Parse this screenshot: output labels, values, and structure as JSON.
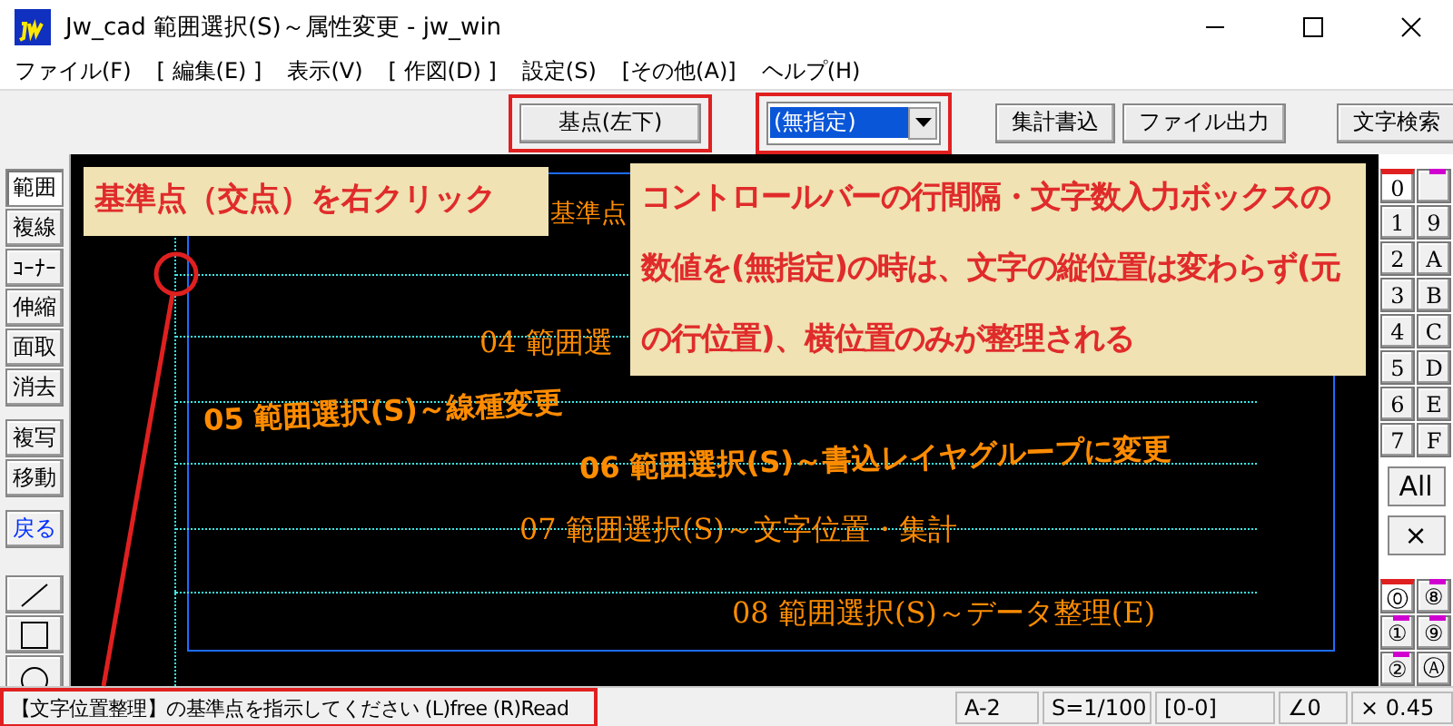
{
  "window": {
    "title": "Jw_cad 範囲選択(S)～属性変更 - jw_win"
  },
  "menu": [
    "ファイル(F)",
    "[ 編集(E) ]",
    "表示(V)",
    "[ 作図(D) ]",
    "設定(S)",
    "[その他(A)]",
    "ヘルプ(H)"
  ],
  "control_bar": {
    "base_button": "基点(左下)",
    "spacing_combo": {
      "value": "(無指定)"
    },
    "buttons": [
      "集計書込",
      "ファイル出力",
      "文字検索"
    ]
  },
  "left_tools": [
    {
      "kind": "text",
      "label": "範囲",
      "selected": true
    },
    {
      "kind": "text",
      "label": "複線",
      "selected": false
    },
    {
      "kind": "text",
      "label": "ｺｰﾅｰ",
      "selected": false
    },
    {
      "kind": "text",
      "label": "伸縮",
      "selected": false
    },
    {
      "kind": "text",
      "label": "面取",
      "selected": false
    },
    {
      "kind": "text",
      "label": "消去",
      "selected": false
    },
    {
      "kind": "text",
      "label": "複写",
      "selected": false
    },
    {
      "kind": "text",
      "label": "移動",
      "selected": false
    },
    {
      "kind": "undo",
      "label": "戻る",
      "selected": false
    },
    {
      "kind": "line",
      "selected": false
    },
    {
      "kind": "rect",
      "selected": false
    },
    {
      "kind": "circle",
      "selected": false
    }
  ],
  "canvas_texts": [
    "基準点",
    "04 範囲選",
    "05 範囲選択(S)～線種変更",
    "06 範囲選択(S)～書込レイヤグループに変更",
    "07 範囲選択(S)～文字位置・集計",
    "08 範囲選択(S)～データ整理(E)"
  ],
  "annotations": [
    {
      "text": "基準点（交点）を右クリック"
    },
    {
      "text": "コントロールバーの行間隔・文字数入力ボックスの数値を(無指定)の時は、文字の縦位置は変わらず(元の行位置)、横位置のみが整理される"
    }
  ],
  "layers": [
    [
      {
        "label": "0",
        "selected": true,
        "marked": false
      },
      {
        "selected": false,
        "marked": true
      }
    ],
    [
      {
        "label": "1",
        "selected": false,
        "marked": false
      },
      {
        "label": "9",
        "selected": false,
        "marked": false
      }
    ],
    [
      {
        "label": "2",
        "selected": false,
        "marked": false
      },
      {
        "label": "A",
        "selected": false,
        "marked": false
      }
    ],
    [
      {
        "label": "3",
        "selected": false,
        "marked": false
      },
      {
        "label": "B",
        "selected": false,
        "marked": false
      }
    ],
    [
      {
        "label": "4",
        "selected": false,
        "marked": false
      },
      {
        "label": "C",
        "selected": false,
        "marked": false
      }
    ],
    [
      {
        "label": "5",
        "selected": false,
        "marked": false
      },
      {
        "label": "D",
        "selected": false,
        "marked": false
      }
    ],
    [
      {
        "label": "6",
        "selected": false,
        "marked": false
      },
      {
        "label": "E",
        "selected": false,
        "marked": false
      }
    ],
    [
      {
        "label": "7",
        "selected": false,
        "marked": false
      },
      {
        "label": "F",
        "selected": false,
        "marked": false
      }
    ]
  ],
  "layer_buttons": [
    "All",
    "×"
  ],
  "groups": [
    [
      {
        "label": "⓪",
        "selected": true,
        "marked": false
      },
      {
        "label": "⑧",
        "selected": false,
        "marked": true
      }
    ],
    [
      {
        "label": "①",
        "selected": false,
        "marked": true
      },
      {
        "label": "⑨",
        "selected": false,
        "marked": true
      }
    ],
    [
      {
        "label": "②",
        "selected": false,
        "marked": true
      },
      {
        "label": "Ⓐ",
        "selected": false,
        "marked": false
      }
    ]
  ],
  "status_bar": {
    "message": "【文字位置整理】の基準点を指示してください (L)free (R)Read",
    "fields": [
      "A-2",
      "S=1/100",
      "[0-0]",
      "∠0",
      "× 0.45"
    ]
  }
}
